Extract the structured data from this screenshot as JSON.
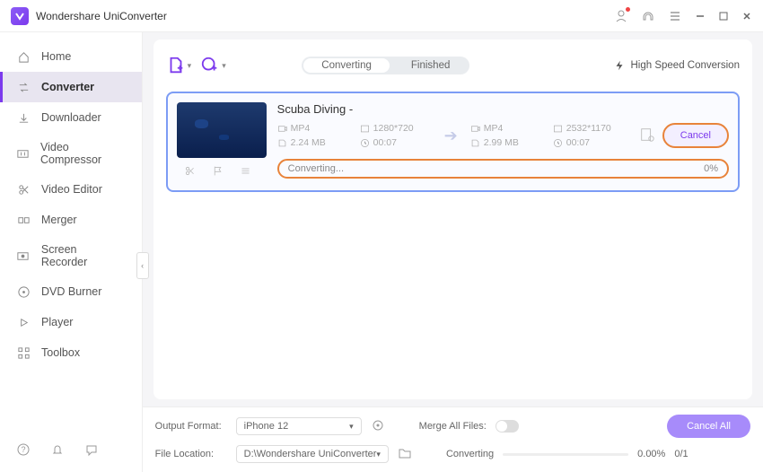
{
  "app": {
    "title": "Wondershare UniConverter"
  },
  "sidebar": {
    "items": [
      {
        "label": "Home"
      },
      {
        "label": "Converter"
      },
      {
        "label": "Downloader"
      },
      {
        "label": "Video Compressor"
      },
      {
        "label": "Video Editor"
      },
      {
        "label": "Merger"
      },
      {
        "label": "Screen Recorder"
      },
      {
        "label": "DVD Burner"
      },
      {
        "label": "Player"
      },
      {
        "label": "Toolbox"
      }
    ]
  },
  "toolbar": {
    "tabs": {
      "converting": "Converting",
      "finished": "Finished"
    },
    "high_speed": "High Speed Conversion"
  },
  "item": {
    "title": "Scuba Diving -",
    "src": {
      "format": "MP4",
      "res": "1280*720",
      "size": "2.24 MB",
      "dur": "00:07"
    },
    "dst": {
      "format": "MP4",
      "res": "2532*1170",
      "size": "2.99 MB",
      "dur": "00:07"
    },
    "cancel_label": "Cancel",
    "progress": {
      "status": "Converting...",
      "pct": "0%"
    }
  },
  "footer": {
    "output_format_label": "Output Format:",
    "output_format_value": "iPhone 12",
    "merge_label": "Merge All Files:",
    "location_label": "File Location:",
    "location_value": "D:\\Wondershare UniConverter",
    "converting_label": "Converting",
    "converting_pct": "0.00%",
    "converting_count": "0/1",
    "cancel_all": "Cancel All"
  }
}
